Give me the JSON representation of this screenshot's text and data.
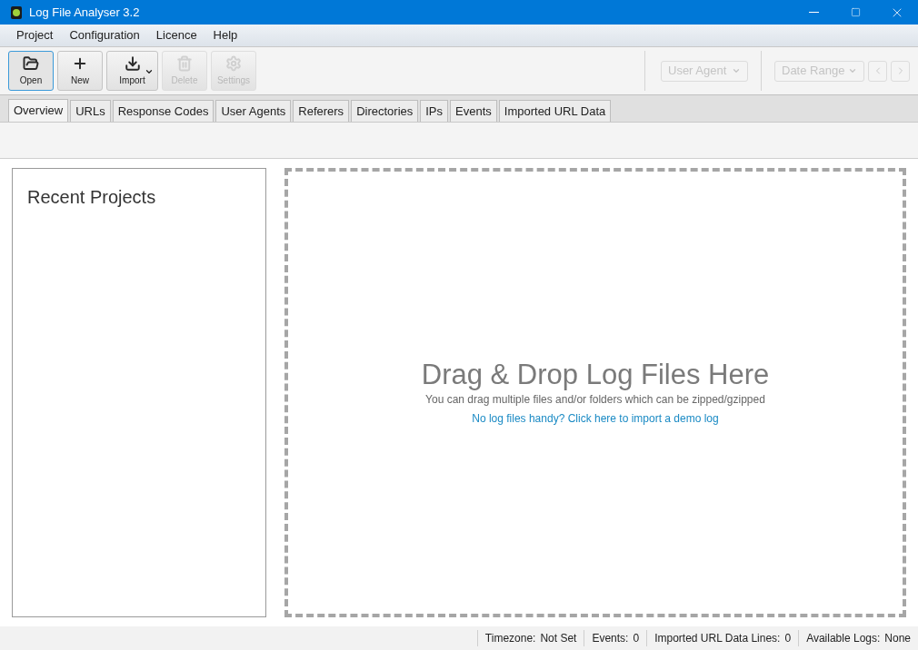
{
  "window": {
    "title": "Log File Analyser 3.2"
  },
  "menu": [
    "Project",
    "Configuration",
    "Licence",
    "Help"
  ],
  "toolbar": [
    {
      "label": "Open",
      "kind": "open",
      "selected": true,
      "disabled": false,
      "dropdown": false
    },
    {
      "label": "New",
      "kind": "new",
      "selected": false,
      "disabled": false,
      "dropdown": false
    },
    {
      "label": "Import",
      "kind": "import",
      "selected": false,
      "disabled": false,
      "dropdown": true
    },
    {
      "label": "Delete",
      "kind": "delete",
      "selected": false,
      "disabled": true,
      "dropdown": false
    },
    {
      "label": "Settings",
      "kind": "settings",
      "selected": false,
      "disabled": true,
      "dropdown": false
    }
  ],
  "filters": {
    "user_agent": {
      "label": "User Agent",
      "disabled": true
    },
    "date_range": {
      "label": "Date Range",
      "disabled": true
    },
    "prev_disabled": true,
    "next_disabled": true
  },
  "tabs": [
    {
      "label": "Overview",
      "selected": true
    },
    {
      "label": "URLs",
      "selected": false
    },
    {
      "label": "Response Codes",
      "selected": false
    },
    {
      "label": "User Agents",
      "selected": false
    },
    {
      "label": "Referers",
      "selected": false
    },
    {
      "label": "Directories",
      "selected": false
    },
    {
      "label": "IPs",
      "selected": false
    },
    {
      "label": "Events",
      "selected": false
    },
    {
      "label": "Imported URL Data",
      "selected": false
    }
  ],
  "recent_projects": {
    "title": "Recent Projects"
  },
  "drop_zone": {
    "title": "Drag & Drop Log Files Here",
    "subtitle": "You can drag multiple files and/or folders which can be zipped/gzipped",
    "link": "No log files handy? Click here to import a demo log"
  },
  "status_bar": [
    {
      "label": "Timezone:",
      "value": "Not Set"
    },
    {
      "label": "Events:",
      "value": "0"
    },
    {
      "label": "Imported URL Data Lines:",
      "value": "0"
    },
    {
      "label": "Available Logs:",
      "value": "None"
    }
  ]
}
